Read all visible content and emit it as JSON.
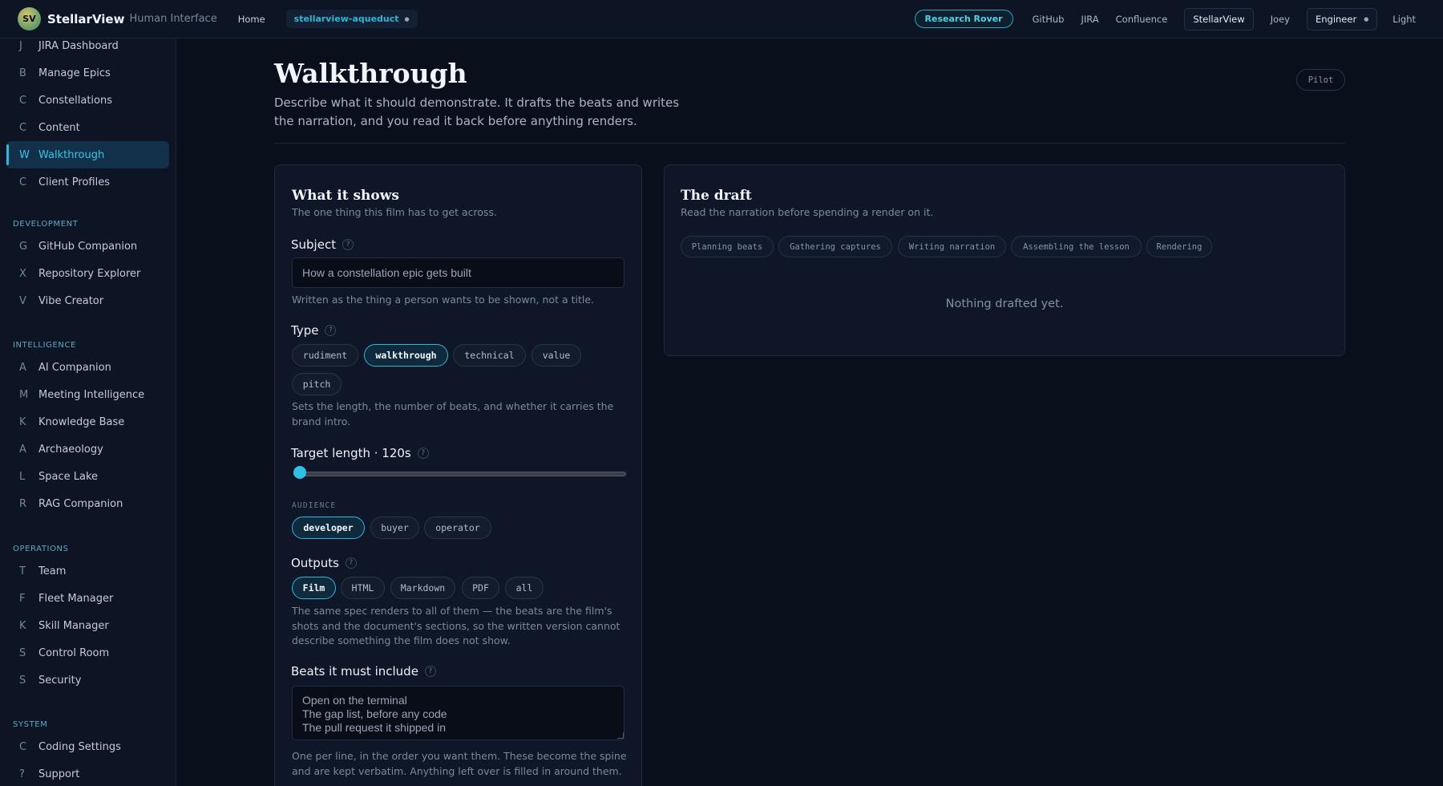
{
  "topbar": {
    "logo_initials": "SV",
    "brand": "StellarView",
    "brand_sub": "Human Interface",
    "home": "Home",
    "env": "stellarview-aqueduct",
    "rover": "Research Rover",
    "links": [
      "GitHub",
      "JIRA",
      "Confluence"
    ],
    "active_app": "StellarView",
    "user": "Joey",
    "role": "Engineer",
    "theme": "Light"
  },
  "sidebar": {
    "top_items": [
      {
        "letter": "J",
        "label": "JIRA Dashboard"
      },
      {
        "letter": "B",
        "label": "Manage Epics"
      },
      {
        "letter": "C",
        "label": "Constellations"
      },
      {
        "letter": "C",
        "label": "Content"
      },
      {
        "letter": "W",
        "label": "Walkthrough"
      },
      {
        "letter": "C",
        "label": "Client Profiles"
      }
    ],
    "development": {
      "title": "DEVELOPMENT",
      "items": [
        {
          "letter": "G",
          "label": "GitHub Companion"
        },
        {
          "letter": "X",
          "label": "Repository Explorer"
        },
        {
          "letter": "V",
          "label": "Vibe Creator"
        }
      ]
    },
    "intelligence": {
      "title": "INTELLIGENCE",
      "items": [
        {
          "letter": "A",
          "label": "AI Companion"
        },
        {
          "letter": "M",
          "label": "Meeting Intelligence"
        },
        {
          "letter": "K",
          "label": "Knowledge Base"
        },
        {
          "letter": "A",
          "label": "Archaeology"
        },
        {
          "letter": "L",
          "label": "Space Lake"
        },
        {
          "letter": "R",
          "label": "RAG Companion"
        }
      ]
    },
    "operations": {
      "title": "OPERATIONS",
      "items": [
        {
          "letter": "T",
          "label": "Team"
        },
        {
          "letter": "F",
          "label": "Fleet Manager"
        },
        {
          "letter": "K",
          "label": "Skill Manager"
        },
        {
          "letter": "S",
          "label": "Control Room"
        },
        {
          "letter": "S",
          "label": "Security"
        }
      ]
    },
    "system": {
      "title": "SYSTEM",
      "items": [
        {
          "letter": "C",
          "label": "Coding Settings"
        },
        {
          "letter": "?",
          "label": "Support"
        }
      ]
    }
  },
  "page": {
    "title": "Walkthrough",
    "description": "Describe what it should demonstrate. It drafts the beats and writes the narration, and you read it back before anything renders.",
    "badge": "Pilot"
  },
  "form": {
    "title": "What it shows",
    "subtitle": "The one thing this film has to get across.",
    "subject_label": "Subject",
    "subject_placeholder": "How a constellation epic gets built",
    "subject_hint": "Written as the thing a person wants to be shown, not a title.",
    "type_label": "Type",
    "types": [
      "rudiment",
      "walkthrough",
      "technical",
      "value",
      "pitch"
    ],
    "type_hint": "Sets the length, the number of beats, and whether it carries the brand intro.",
    "length_label": "Target length · 120s",
    "audience_label": "AUDIENCE",
    "audiences": [
      "developer",
      "buyer",
      "operator"
    ],
    "outputs_label": "Outputs",
    "outputs": [
      "Film",
      "HTML",
      "Markdown",
      "PDF",
      "all"
    ],
    "outputs_hint": "The same spec renders to all of them — the beats are the film's shots and the document's sections, so the written version cannot describe something the film does not show.",
    "beats_label": "Beats it must include",
    "beats_value": "Open on the terminal\nThe gap list, before any code\nThe pull request it shipped in",
    "beats_hint": "One per line, in the order you want them. These become the spine and are kept verbatim. Anything left over is filled in around them."
  },
  "draft": {
    "title": "The draft",
    "subtitle": "Read the narration before spending a render on it.",
    "steps": [
      "Planning beats",
      "Gathering captures",
      "Writing narration",
      "Assembling the lesson",
      "Rendering"
    ],
    "empty": "Nothing drafted yet."
  },
  "colors": {
    "accent": "#2fb6d6",
    "background": "#0a0f1c",
    "panel": "#0e1628"
  }
}
